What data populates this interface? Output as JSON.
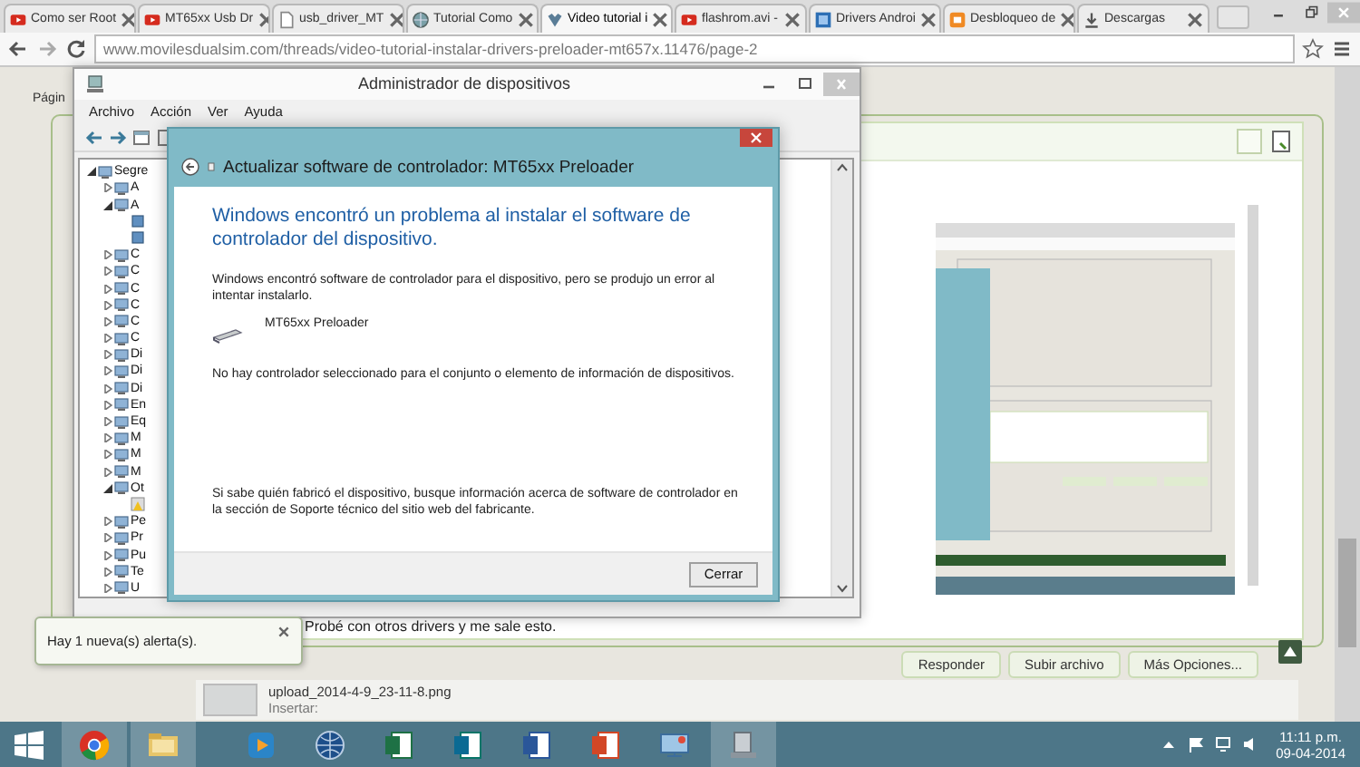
{
  "browser": {
    "tabs": [
      {
        "label": "Como ser Root",
        "kind": "video",
        "selected": false
      },
      {
        "label": "MT65xx Usb Dr",
        "kind": "video",
        "selected": false
      },
      {
        "label": "usb_driver_MT",
        "kind": "page",
        "selected": false
      },
      {
        "label": "Tutorial Como",
        "kind": "globe",
        "selected": false
      },
      {
        "label": "Video tutorial i",
        "kind": "leaf",
        "selected": true
      },
      {
        "label": "flashrom.avi -",
        "kind": "video",
        "selected": false
      },
      {
        "label": "Drivers Androi",
        "kind": "square",
        "selected": false
      },
      {
        "label": "Desbloqueo de",
        "kind": "blog",
        "selected": false
      },
      {
        "label": "Descargas",
        "kind": "download",
        "selected": false
      }
    ],
    "url": "www.movilesdualsim.com/threads/video-tutorial-instalar-drivers-preloader-mt657x.11476/page-2"
  },
  "page": {
    "label": "Págin",
    "post_text": "Probé con otros drivers y me sale esto.",
    "buttons": [
      "Responder",
      "Subir archivo",
      "Más Opciones..."
    ],
    "attachment": {
      "filename": "upload_2014-4-9_23-11-8.png",
      "action": "Insertar:"
    }
  },
  "device_manager": {
    "title": "Administrador de dispositivos",
    "menu": [
      "Archivo",
      "Acción",
      "Ver",
      "Ayuda"
    ],
    "tree": [
      {
        "kind": "category",
        "label": "Segre",
        "expanded": true,
        "children": [
          {
            "kind": "category",
            "label": "A",
            "expanded": false
          },
          {
            "kind": "category",
            "label": "A",
            "expanded": true,
            "children": [
              {
                "kind": "device"
              },
              {
                "kind": "device"
              }
            ]
          },
          {
            "kind": "category",
            "label": "C",
            "expanded": false
          },
          {
            "kind": "category",
            "label": "C",
            "expanded": false
          },
          {
            "kind": "category",
            "label": "C",
            "expanded": false
          },
          {
            "kind": "category",
            "label": "C",
            "expanded": false
          },
          {
            "kind": "category",
            "label": "C",
            "expanded": false
          },
          {
            "kind": "category",
            "label": "C",
            "expanded": false
          },
          {
            "kind": "category",
            "label": "Di",
            "expanded": false
          },
          {
            "kind": "category",
            "label": "Di",
            "expanded": false
          },
          {
            "kind": "category",
            "label": "Di",
            "expanded": false
          },
          {
            "kind": "category",
            "label": "En",
            "expanded": false
          },
          {
            "kind": "category",
            "label": "Eq",
            "expanded": false
          },
          {
            "kind": "category",
            "label": "M",
            "expanded": false
          },
          {
            "kind": "category",
            "label": "M",
            "expanded": false
          },
          {
            "kind": "category",
            "label": "M",
            "expanded": false
          },
          {
            "kind": "category",
            "label": "Ot",
            "expanded": true,
            "children": [
              {
                "kind": "warning"
              }
            ]
          },
          {
            "kind": "category",
            "label": "Pe",
            "expanded": false
          },
          {
            "kind": "category",
            "label": "Pr",
            "expanded": false
          },
          {
            "kind": "category",
            "label": "Pu",
            "expanded": false
          },
          {
            "kind": "category",
            "label": "Te",
            "expanded": false
          },
          {
            "kind": "category",
            "label": "U",
            "expanded": false
          }
        ]
      }
    ]
  },
  "dialog": {
    "title": "Actualizar software de controlador: MT65xx Preloader",
    "heading": "Windows encontró un problema al instalar el software de controlador del dispositivo.",
    "message": "Windows encontró software de controlador para el dispositivo, pero se produjo un error al intentar instalarlo.",
    "device_name": "MT65xx Preloader",
    "error": "No hay controlador seleccionado para el conjunto o elemento de información de dispositivos.",
    "hint": "Si sabe quién fabricó el dispositivo, busque información acerca de software de controlador en la sección de Soporte técnico del sitio web del fabricante.",
    "close_button": "Cerrar"
  },
  "alert": {
    "text": "Hay 1 nueva(s) alerta(s)."
  },
  "taskbar": {
    "apps": [
      {
        "kind": "chrome",
        "active": true
      },
      {
        "kind": "folder",
        "active": true
      },
      {
        "kind": "media",
        "active": false
      },
      {
        "kind": "globe",
        "active": false
      },
      {
        "kind": "excel",
        "active": false
      },
      {
        "kind": "publisher",
        "active": false
      },
      {
        "kind": "word",
        "active": false
      },
      {
        "kind": "powerpoint",
        "active": false
      },
      {
        "kind": "network",
        "active": false
      },
      {
        "kind": "devices",
        "active": true
      }
    ],
    "time": "11:11 p.m.",
    "date": "09-04-2014"
  }
}
